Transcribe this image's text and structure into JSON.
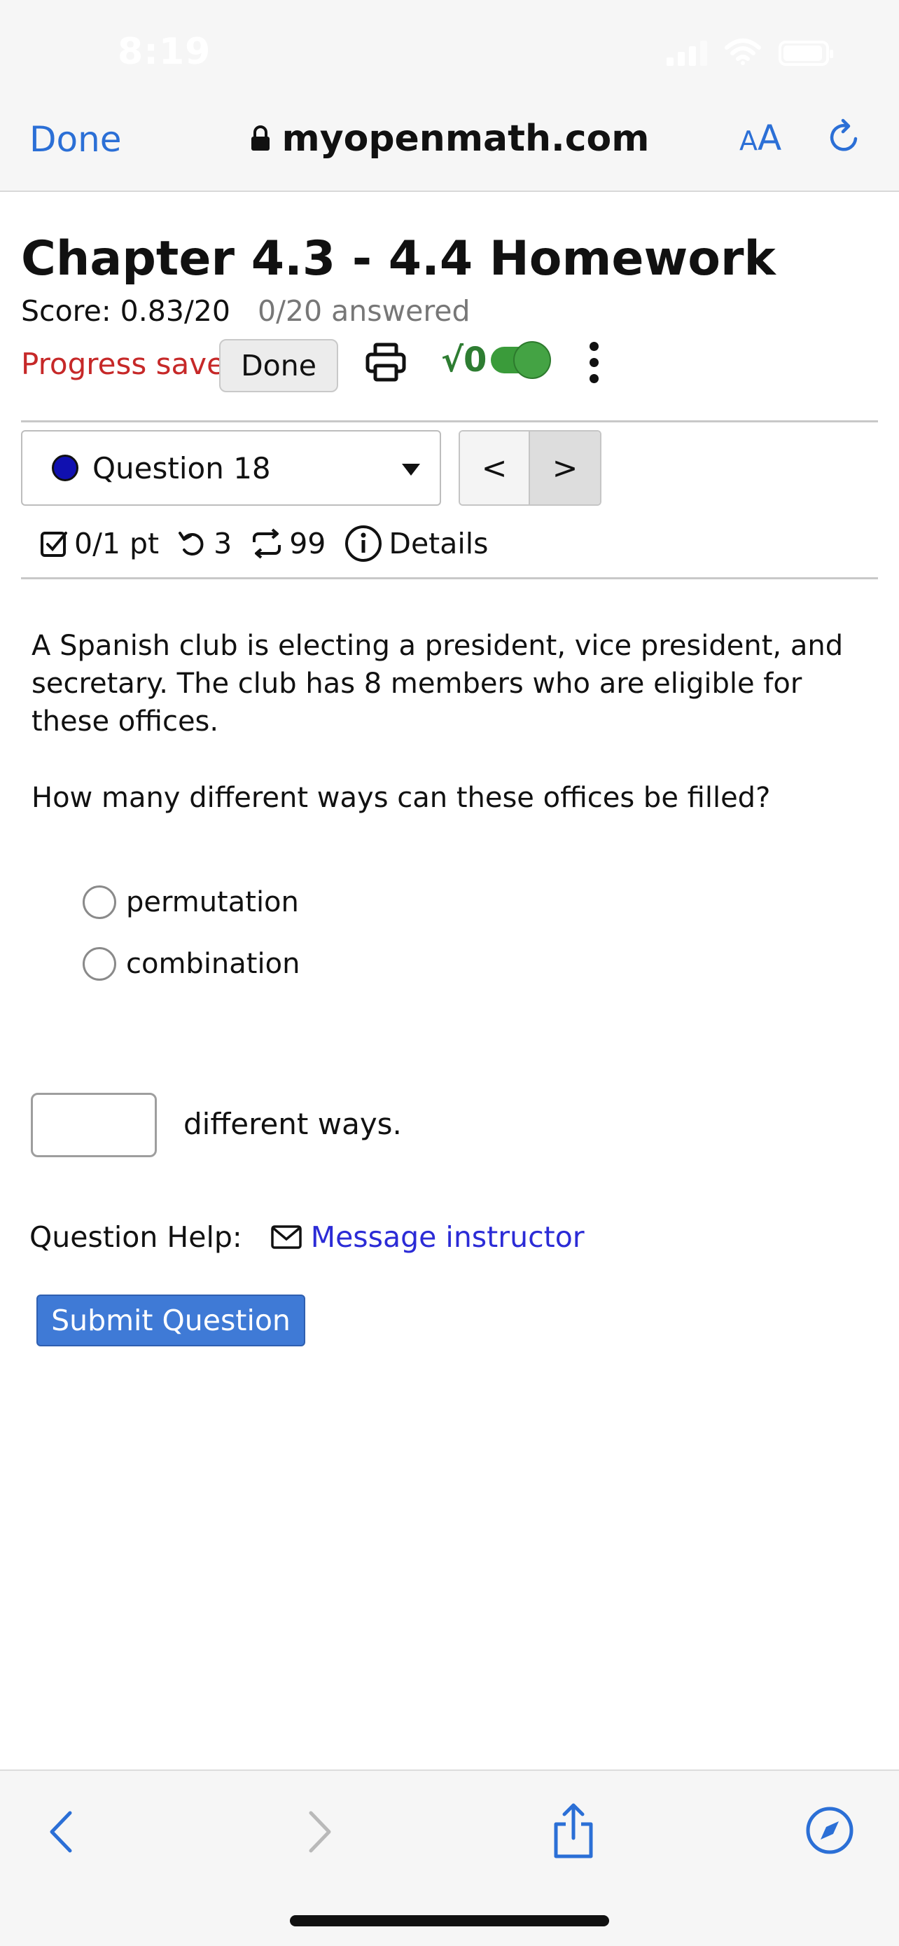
{
  "status_bar": {
    "time": "8:19"
  },
  "browser": {
    "done_label": "Done",
    "url": "myopenmath.com",
    "text_size_label_small": "A",
    "text_size_label_large": "A"
  },
  "page": {
    "title": "Chapter 4.3 - 4.4 Homework",
    "score": "Score: 0.83/20",
    "answered": "0/20 answered",
    "progress_saved": "Progress saved",
    "done_label": "Done",
    "sqrt_label": "√0"
  },
  "question_nav": {
    "selected": "Question 18",
    "prev_symbol": "<",
    "next_symbol": ">"
  },
  "question_meta": {
    "points": "0/1 pt",
    "retries": "3",
    "attempts": "99",
    "details_label": "Details"
  },
  "question": {
    "text": "A Spanish club is electing a president, vice president, and secretary. The club has 8 members who are eligible for these offices.",
    "prompt": "How many different ways can these offices be filled?",
    "options": [
      "permutation",
      "combination"
    ],
    "answer_value": "",
    "answer_suffix": "different ways."
  },
  "help": {
    "label": "Question Help:",
    "message_label": "Message instructor"
  },
  "submit_label": "Submit Question",
  "colors": {
    "accent": "#2b6fd6",
    "progress_saved": "#c62828",
    "submit": "#3f7ad6",
    "toggle_on": "#44a344"
  }
}
